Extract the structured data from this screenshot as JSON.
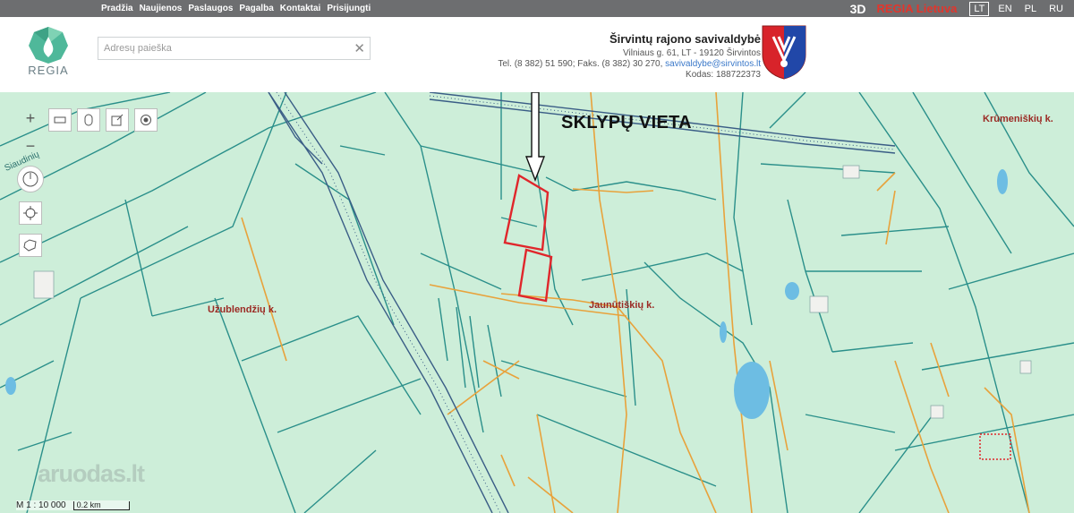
{
  "nav": {
    "items": [
      "Pradžia",
      "Naujienos",
      "Paslaugos",
      "Pagalba",
      "Kontaktai",
      "Prisijungti"
    ]
  },
  "top_right": {
    "btn_3d": "3D",
    "regia_lietuva": "REGIA Lietuva",
    "languages": [
      "LT",
      "EN",
      "PL",
      "RU"
    ],
    "active_language": "LT"
  },
  "logo": {
    "text": "REGIA"
  },
  "search": {
    "placeholder": "Adresų paieška",
    "value": ""
  },
  "municipality": {
    "name": "Širvintų rajono savivaldybė",
    "address": "Vilniaus g. 61, LT - 19120 Širvintos",
    "phone_prefix": "Tel. (8 382) 51 590; Faks. (8 382) 30 270,",
    "email": "savivaldybe@sirvintos.lt",
    "code": "Kodas: 188722373"
  },
  "map": {
    "annotation": "SKLYPŲ VIETA",
    "places": {
      "uzublendziu": "Užublendžių k.",
      "jaunutiskiu": "Jaunūtiškių k.",
      "krumeniskiu": "Krūmeniškių k.",
      "road_label": "Siaudinių"
    },
    "scale_ratio": "M 1 : 10 000",
    "scale_bar": "0.2 km",
    "watermark": "aruodas.lt"
  },
  "colors": {
    "map_fill": "#cdeed9",
    "parcel_line": "#2a8f8a",
    "orange_line": "#e8a23b",
    "highlight": "#e0262b",
    "railway": "#3a5d86",
    "topbar": "#6d6e70",
    "regia_red": "#e2352c"
  }
}
